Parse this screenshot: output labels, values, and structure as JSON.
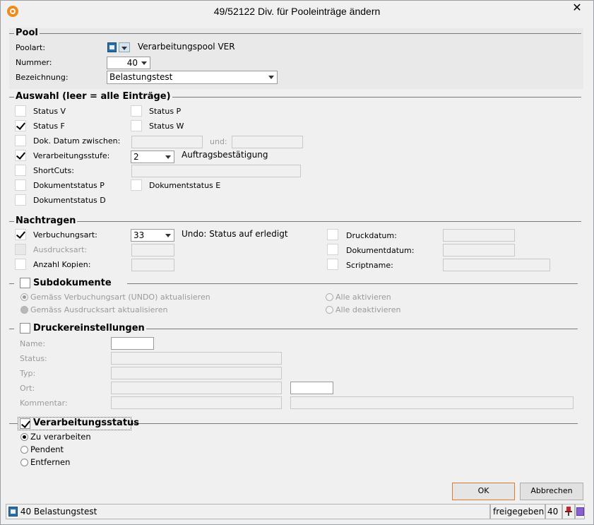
{
  "window": {
    "title": "49/52122 Div. für Pooleinträge ändern",
    "close_symbol": "✕",
    "accent": "#f08a1c"
  },
  "pool": {
    "title": "Pool",
    "poolart_label": "Poolart:",
    "poolart_value": "Verarbeitungspool VER",
    "nummer_label": "Nummer:",
    "nummer_value": "40",
    "bezeichnung_label": "Bezeichnung:",
    "bezeichnung_value": "Belastungstest"
  },
  "auswahl": {
    "title": "Auswahl (leer = alle Einträge)",
    "status_v": {
      "label": "Status V",
      "checked": false
    },
    "status_p": {
      "label": "Status P",
      "checked": false
    },
    "status_f": {
      "label": "Status F",
      "checked": true
    },
    "status_w": {
      "label": "Status W",
      "checked": false
    },
    "dok_datum": {
      "label": "Dok. Datum zwischen:",
      "checked": false,
      "und_label": "und:"
    },
    "verarbeitungsstufe": {
      "label": "Verarbeitungsstufe:",
      "checked": true,
      "value": "2",
      "description": "Auftragsbestätigung"
    },
    "shortcuts": {
      "label": "ShortCuts:",
      "checked": false
    },
    "dokumentstatus_p": {
      "label": "Dokumentstatus P",
      "checked": false
    },
    "dokumentstatus_e": {
      "label": "Dokumentstatus E",
      "checked": false
    },
    "dokumentstatus_d": {
      "label": "Dokumentstatus D",
      "checked": false
    }
  },
  "nachtragen": {
    "title": "Nachtragen",
    "verbuchungsart": {
      "label": "Verbuchungsart:",
      "checked": true,
      "value": "33",
      "description": "Undo: Status auf erledigt"
    },
    "ausdrucksart": {
      "label": "Ausdrucksart:",
      "checked": false
    },
    "anzahl_kopien": {
      "label": "Anzahl Kopien:",
      "checked": false
    },
    "druckdatum": {
      "label": "Druckdatum:",
      "checked": false
    },
    "dokumentdatum": {
      "label": "Dokumentdatum:",
      "checked": false
    },
    "scriptname": {
      "label": "Scriptname:",
      "checked": false
    }
  },
  "subdokumente": {
    "title": "Subdokumente",
    "checked": false,
    "options_left": [
      {
        "label": "Gemäss Verbuchungsart (UNDO) aktualisieren",
        "selected": true
      },
      {
        "label": "Gemäss Ausdrucksart aktualisieren",
        "selected": false
      }
    ],
    "options_right": [
      {
        "label": "Alle aktivieren",
        "selected": false
      },
      {
        "label": "Alle deaktivieren",
        "selected": false
      }
    ]
  },
  "druckereinstellungen": {
    "title": "Druckereinstellungen",
    "checked": false,
    "name_label": "Name:",
    "status_label": "Status:",
    "typ_label": "Typ:",
    "ort_label": "Ort:",
    "kommentar_label": "Kommentar:"
  },
  "verarbeitungsstatus": {
    "title": "Verarbeitungsstatus",
    "checked": true,
    "options": [
      {
        "label": "Zu verarbeiten",
        "selected": true
      },
      {
        "label": "Pendent",
        "selected": false
      },
      {
        "label": "Entfernen",
        "selected": false
      }
    ]
  },
  "buttons": {
    "ok": "OK",
    "cancel": "Abbrechen"
  },
  "statusbar": {
    "record": "40 Belastungstest",
    "state": "freigegeben",
    "number": "40"
  }
}
